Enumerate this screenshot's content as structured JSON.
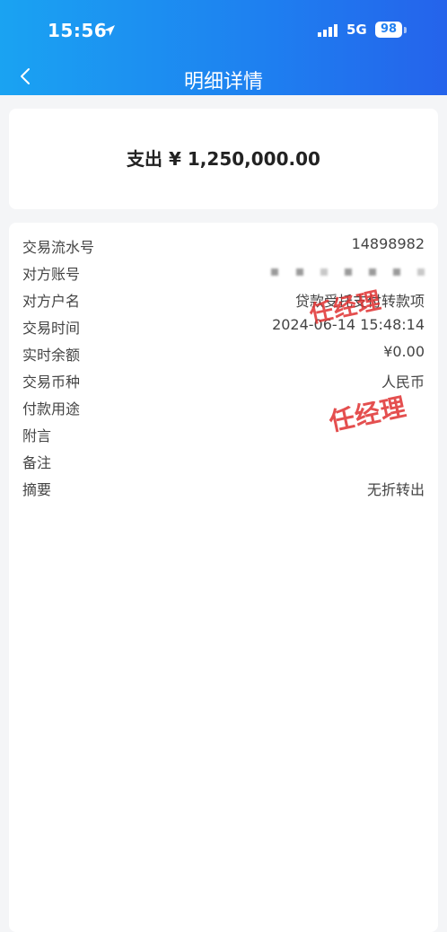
{
  "status_bar": {
    "time": "15:56",
    "network": "5G",
    "battery": "98"
  },
  "header": {
    "title": "明细详情"
  },
  "amount": {
    "text": "支出 ¥ 1,250,000.00"
  },
  "details": [
    {
      "label": "交易流水号",
      "value": "14898982"
    },
    {
      "label": "对方账号",
      "value": ""
    },
    {
      "label": "对方户名",
      "value": "贷款受托支付转款项"
    },
    {
      "label": "交易时间",
      "value": "2024-06-14 15:48:14"
    },
    {
      "label": "实时余额",
      "value": "¥0.00"
    },
    {
      "label": "交易币种",
      "value": "人民币"
    },
    {
      "label": "付款用途",
      "value": ""
    },
    {
      "label": "附言",
      "value": ""
    },
    {
      "label": "备注",
      "value": ""
    },
    {
      "label": "摘要",
      "value": "无折转出"
    }
  ],
  "stamps": {
    "stamp_1": "任经理",
    "stamp_2": "任经理"
  },
  "colors": {
    "header_start": "#1aa3f2",
    "header_end": "#2563eb",
    "stamp": "#e03131"
  }
}
